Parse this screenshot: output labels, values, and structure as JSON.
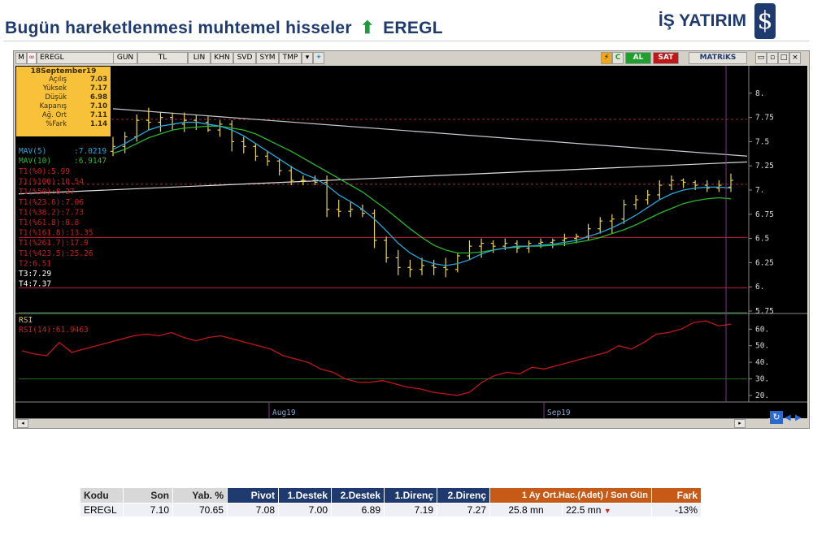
{
  "header": {
    "title": "Bugün hareketlenmesi muhtemel hisseler",
    "symbol": "EREGL",
    "arrow": "⬆"
  },
  "brand": {
    "name": "İŞ YATIRIM",
    "logo_glyph": "$"
  },
  "toolbar": {
    "m": "M",
    "symbol": "EREGL",
    "buttons": [
      "GUN",
      "TL",
      "LIN",
      "KHN",
      "SVD",
      "SYM",
      "TMP"
    ],
    "c": "C",
    "al": "AL",
    "sat": "SAT",
    "matriks": "MATRiKS"
  },
  "info_box": {
    "date": "18September19",
    "rows": [
      {
        "label": "Açılış",
        "value": "7.03"
      },
      {
        "label": "Yüksek",
        "value": "7.17"
      },
      {
        "label": "Düşük",
        "value": "6.98"
      },
      {
        "label": "Kapanış",
        "value": "7.10"
      },
      {
        "label": "Ağ. Ort",
        "value": "7.11"
      },
      {
        "label": "%Fark",
        "value": "1.14"
      }
    ]
  },
  "legend": {
    "mav5": "MAV(5)",
    "mav5_val": ":7.0219",
    "mav10": "MAV(10)",
    "mav10_val": ":6.9147",
    "fib": [
      "T1(%0):5.99",
      "T1(%100):10.54",
      "T1(%50):8.27",
      "T1(%23.6):7.06",
      "T1(%38.2):7.73",
      "T1(%61.8):8.8",
      "T1(%161.8):13.35",
      "T1(%261.7):17.9",
      "T1(%423.5):25.26",
      "T2:6.51"
    ],
    "t3": "T3:7.29",
    "t4": "T4:7.37",
    "rsi": "RSI",
    "rsi14": "RSI(14)",
    "rsi14_val": ":61.9463"
  },
  "chart_data": [
    {
      "type": "ohlc",
      "title": "EREGL",
      "x_labels": [
        "Aug19",
        "Sep19"
      ],
      "ylim": [
        5.75,
        8.25
      ],
      "yticks": [
        "8.",
        "7.75",
        "7.5",
        "7.25",
        "7.",
        "6.75",
        "6.5",
        "6.25",
        "6.",
        "5.75"
      ],
      "bars": [
        {
          "o": 7.4,
          "h": 7.55,
          "l": 7.35,
          "c": 7.45
        },
        {
          "o": 7.45,
          "h": 7.6,
          "l": 7.38,
          "c": 7.55
        },
        {
          "o": 7.55,
          "h": 7.78,
          "l": 7.5,
          "c": 7.72
        },
        {
          "o": 7.72,
          "h": 7.85,
          "l": 7.62,
          "c": 7.7
        },
        {
          "o": 7.7,
          "h": 7.8,
          "l": 7.6,
          "c": 7.75
        },
        {
          "o": 7.75,
          "h": 7.8,
          "l": 7.62,
          "c": 7.68
        },
        {
          "o": 7.68,
          "h": 7.8,
          "l": 7.6,
          "c": 7.72
        },
        {
          "o": 7.72,
          "h": 7.78,
          "l": 7.62,
          "c": 7.7
        },
        {
          "o": 7.7,
          "h": 7.76,
          "l": 7.6,
          "c": 7.62
        },
        {
          "o": 7.62,
          "h": 7.72,
          "l": 7.55,
          "c": 7.68
        },
        {
          "o": 7.68,
          "h": 7.72,
          "l": 7.4,
          "c": 7.5
        },
        {
          "o": 7.5,
          "h": 7.55,
          "l": 7.38,
          "c": 7.45
        },
        {
          "o": 7.45,
          "h": 7.48,
          "l": 7.3,
          "c": 7.35
        },
        {
          "o": 7.35,
          "h": 7.4,
          "l": 7.25,
          "c": 7.3
        },
        {
          "o": 7.3,
          "h": 7.32,
          "l": 7.15,
          "c": 7.2
        },
        {
          "o": 7.2,
          "h": 7.25,
          "l": 7.05,
          "c": 7.1
        },
        {
          "o": 7.1,
          "h": 7.15,
          "l": 7.05,
          "c": 7.1
        },
        {
          "o": 7.1,
          "h": 7.15,
          "l": 7.05,
          "c": 7.08
        },
        {
          "o": 7.08,
          "h": 7.15,
          "l": 6.72,
          "c": 6.8
        },
        {
          "o": 6.8,
          "h": 6.9,
          "l": 6.72,
          "c": 6.78
        },
        {
          "o": 6.78,
          "h": 6.88,
          "l": 6.72,
          "c": 6.8
        },
        {
          "o": 6.8,
          "h": 6.85,
          "l": 6.72,
          "c": 6.76
        },
        {
          "o": 6.76,
          "h": 6.8,
          "l": 6.4,
          "c": 6.48
        },
        {
          "o": 6.48,
          "h": 6.52,
          "l": 6.25,
          "c": 6.3
        },
        {
          "o": 6.3,
          "h": 6.38,
          "l": 6.12,
          "c": 6.2
        },
        {
          "o": 6.2,
          "h": 6.28,
          "l": 6.1,
          "c": 6.18
        },
        {
          "o": 6.18,
          "h": 6.3,
          "l": 6.12,
          "c": 6.22
        },
        {
          "o": 6.22,
          "h": 6.28,
          "l": 6.12,
          "c": 6.2
        },
        {
          "o": 6.2,
          "h": 6.3,
          "l": 6.1,
          "c": 6.18
        },
        {
          "o": 6.18,
          "h": 6.35,
          "l": 6.15,
          "c": 6.32
        },
        {
          "o": 6.32,
          "h": 6.48,
          "l": 6.28,
          "c": 6.42
        },
        {
          "o": 6.42,
          "h": 6.5,
          "l": 6.3,
          "c": 6.45
        },
        {
          "o": 6.45,
          "h": 6.48,
          "l": 6.35,
          "c": 6.42
        },
        {
          "o": 6.42,
          "h": 6.5,
          "l": 6.38,
          "c": 6.45
        },
        {
          "o": 6.45,
          "h": 6.48,
          "l": 6.35,
          "c": 6.4
        },
        {
          "o": 6.4,
          "h": 6.48,
          "l": 6.35,
          "c": 6.45
        },
        {
          "o": 6.45,
          "h": 6.5,
          "l": 6.4,
          "c": 6.46
        },
        {
          "o": 6.46,
          "h": 6.5,
          "l": 6.4,
          "c": 6.48
        },
        {
          "o": 6.48,
          "h": 6.55,
          "l": 6.42,
          "c": 6.5
        },
        {
          "o": 6.5,
          "h": 6.55,
          "l": 6.45,
          "c": 6.52
        },
        {
          "o": 6.52,
          "h": 6.65,
          "l": 6.48,
          "c": 6.6
        },
        {
          "o": 6.6,
          "h": 6.72,
          "l": 6.55,
          "c": 6.68
        },
        {
          "o": 6.68,
          "h": 6.75,
          "l": 6.55,
          "c": 6.7
        },
        {
          "o": 6.7,
          "h": 6.9,
          "l": 6.65,
          "c": 6.85
        },
        {
          "o": 6.85,
          "h": 6.95,
          "l": 6.8,
          "c": 6.9
        },
        {
          "o": 6.9,
          "h": 7.0,
          "l": 6.85,
          "c": 6.95
        },
        {
          "o": 6.95,
          "h": 7.1,
          "l": 6.9,
          "c": 7.05
        },
        {
          "o": 7.05,
          "h": 7.15,
          "l": 7.0,
          "c": 7.1
        },
        {
          "o": 7.1,
          "h": 7.12,
          "l": 7.02,
          "c": 7.08
        },
        {
          "o": 7.08,
          "h": 7.1,
          "l": 7.0,
          "c": 7.05
        },
        {
          "o": 7.05,
          "h": 7.1,
          "l": 6.98,
          "c": 7.02
        },
        {
          "o": 7.02,
          "h": 7.1,
          "l": 6.98,
          "c": 7.05
        },
        {
          "o": 7.03,
          "h": 7.17,
          "l": 6.98,
          "c": 7.1
        }
      ],
      "mav5": [
        7.42,
        7.48,
        7.55,
        7.62,
        7.66,
        7.68,
        7.7,
        7.7,
        7.68,
        7.66,
        7.62,
        7.56,
        7.48,
        7.4,
        7.32,
        7.24,
        7.17,
        7.12,
        7.05,
        6.95,
        6.88,
        6.8,
        6.7,
        6.58,
        6.45,
        6.35,
        6.28,
        6.24,
        6.22,
        6.24,
        6.28,
        6.34,
        6.38,
        6.4,
        6.42,
        6.42,
        6.43,
        6.44,
        6.46,
        6.48,
        6.52,
        6.56,
        6.61,
        6.67,
        6.74,
        6.82,
        6.9,
        6.96,
        7.0,
        7.02,
        7.03,
        7.03,
        7.02
      ],
      "mav10": [
        7.38,
        7.42,
        7.48,
        7.54,
        7.58,
        7.62,
        7.64,
        7.65,
        7.66,
        7.66,
        7.64,
        7.62,
        7.58,
        7.52,
        7.46,
        7.4,
        7.33,
        7.26,
        7.19,
        7.12,
        7.05,
        6.98,
        6.89,
        6.8,
        6.7,
        6.6,
        6.51,
        6.43,
        6.38,
        6.35,
        6.35,
        6.36,
        6.38,
        6.4,
        6.41,
        6.42,
        6.42,
        6.43,
        6.44,
        6.46,
        6.48,
        6.51,
        6.55,
        6.59,
        6.64,
        6.7,
        6.76,
        6.81,
        6.86,
        6.89,
        6.91,
        6.92,
        6.91
      ]
    },
    {
      "type": "line",
      "title": "RSI(14)",
      "ylim": [
        18,
        68
      ],
      "yticks": [
        "60.",
        "50.",
        "40.",
        "30.",
        "20."
      ],
      "values": [
        47,
        45,
        44,
        52,
        46,
        48,
        50,
        52,
        54,
        56,
        57,
        56,
        58,
        55,
        53,
        55,
        56,
        54,
        52,
        50,
        48,
        44,
        42,
        40,
        36,
        34,
        30,
        28,
        28,
        29,
        27,
        25,
        24,
        22,
        21,
        20,
        22,
        28,
        32,
        34,
        33,
        37,
        36,
        38,
        40,
        42,
        44,
        46,
        50,
        48,
        52,
        57,
        58,
        60,
        64,
        65,
        62,
        63
      ]
    }
  ],
  "annotations": {
    "x_labels": [
      "Aug19",
      "Sep19"
    ]
  },
  "table": {
    "headers": [
      "Kodu",
      "Son",
      "Yab. %",
      "Pivot",
      "1.Destek",
      "2.Destek",
      "1.Direnç",
      "2.Direnç",
      "1 Ay Ort.Hac.(Adet)  /  Son Gün",
      "Fark"
    ],
    "row": {
      "kodu": "EREGL",
      "son": "7.10",
      "yab": "70.65",
      "pivot": "7.08",
      "destek1": "7.00",
      "destek2": "6.89",
      "direnc1": "7.19",
      "direnc2": "7.27",
      "hacim_ay": "25.8 mn",
      "hacim_gun": "22.5 mn",
      "fark": "-13%"
    }
  },
  "colors": {
    "price_bar": "#e8d44d",
    "mav5": "#2aa8d8",
    "mav10": "#2cb62c",
    "rsi_line": "#c01818",
    "fib_text": "#c82020",
    "navy": "#1f3a6e",
    "orange": "#c75a16"
  }
}
